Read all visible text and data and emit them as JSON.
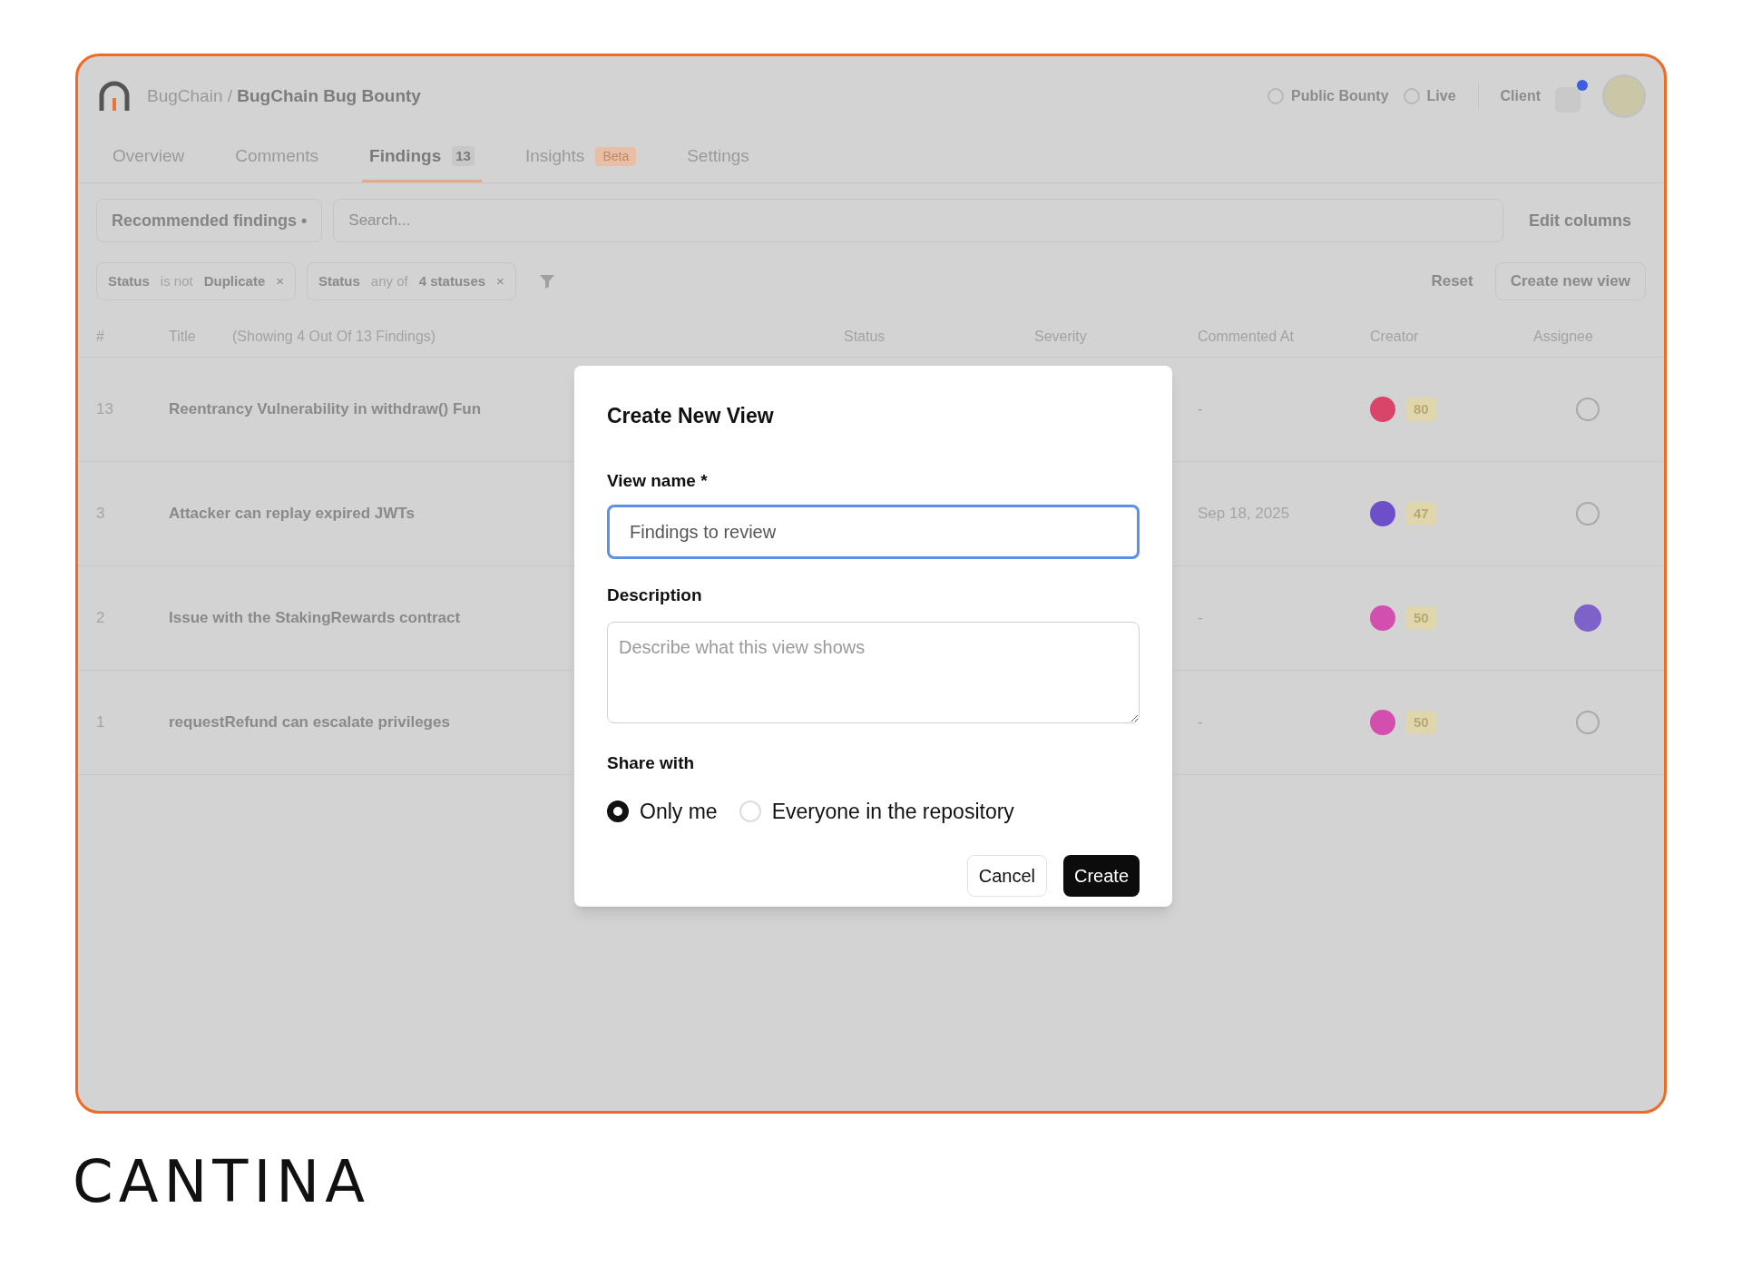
{
  "header": {
    "org": "BugChain",
    "separator": "/",
    "project": "BugChain Bug Bounty",
    "badges": [
      "Public Bounty",
      "Live"
    ],
    "role": "Client",
    "notification": true
  },
  "tabs": [
    {
      "label": "Overview",
      "selected": false
    },
    {
      "label": "Comments",
      "selected": false
    },
    {
      "label": "Findings",
      "count": "13",
      "selected": true
    },
    {
      "label": "Insights",
      "badge": "Beta",
      "selected": false
    },
    {
      "label": "Settings",
      "selected": false
    }
  ],
  "toolbar": {
    "view": "Recommended findings •",
    "search": {
      "placeholder": "Search..."
    },
    "edit_columns": "Edit columns"
  },
  "filters": [
    {
      "field": "Status",
      "operator": "is not",
      "value": "Duplicate",
      "remove": "×"
    },
    {
      "field": "Status",
      "operator": "any of",
      "value": "4 statuses",
      "remove": "×"
    }
  ],
  "filter_actions": {
    "reset": "Reset",
    "create": "Create new view"
  },
  "table": {
    "columns": [
      "#",
      "Title",
      "(Showing 4 Out Of 13 Findings)",
      "Status",
      "Severity",
      "Commented At",
      "Creator",
      "Assignee"
    ],
    "rows": [
      {
        "number": "13",
        "title": "Reentrancy Vulnerability in withdraw() Fun",
        "commented_at": "-",
        "color": "#d9446a",
        "score": "80",
        "assigned": false
      },
      {
        "number": "3",
        "title": "Attacker can replay expired JWTs",
        "commented_at": "Sep 18, 2025",
        "color": "#6d4fc9",
        "score": "47",
        "assigned": false
      },
      {
        "number": "2",
        "title": "Issue with the StakingRewards contract",
        "commented_at": "-",
        "color": "#d24fb0",
        "score": "50",
        "assigned": true
      },
      {
        "number": "1",
        "title": "requestRefund can escalate privileges",
        "commented_at": "-",
        "color": "#d24fb0",
        "score": "50",
        "assigned": false
      }
    ]
  },
  "dialog": {
    "title": "Create New View",
    "name_label": "View name *",
    "name_value": "Findings to review",
    "description_label": "Description",
    "description_placeholder": "Describe what this view shows",
    "share_label": "Share with",
    "share_options": [
      {
        "label": "Only me",
        "selected": true
      },
      {
        "label": "Everyone in the repository",
        "selected": false
      }
    ],
    "buttons": [
      {
        "label": "Cancel",
        "kind": "secondary"
      },
      {
        "label": "Create",
        "kind": "primary"
      }
    ]
  },
  "brand": "CANTINA"
}
